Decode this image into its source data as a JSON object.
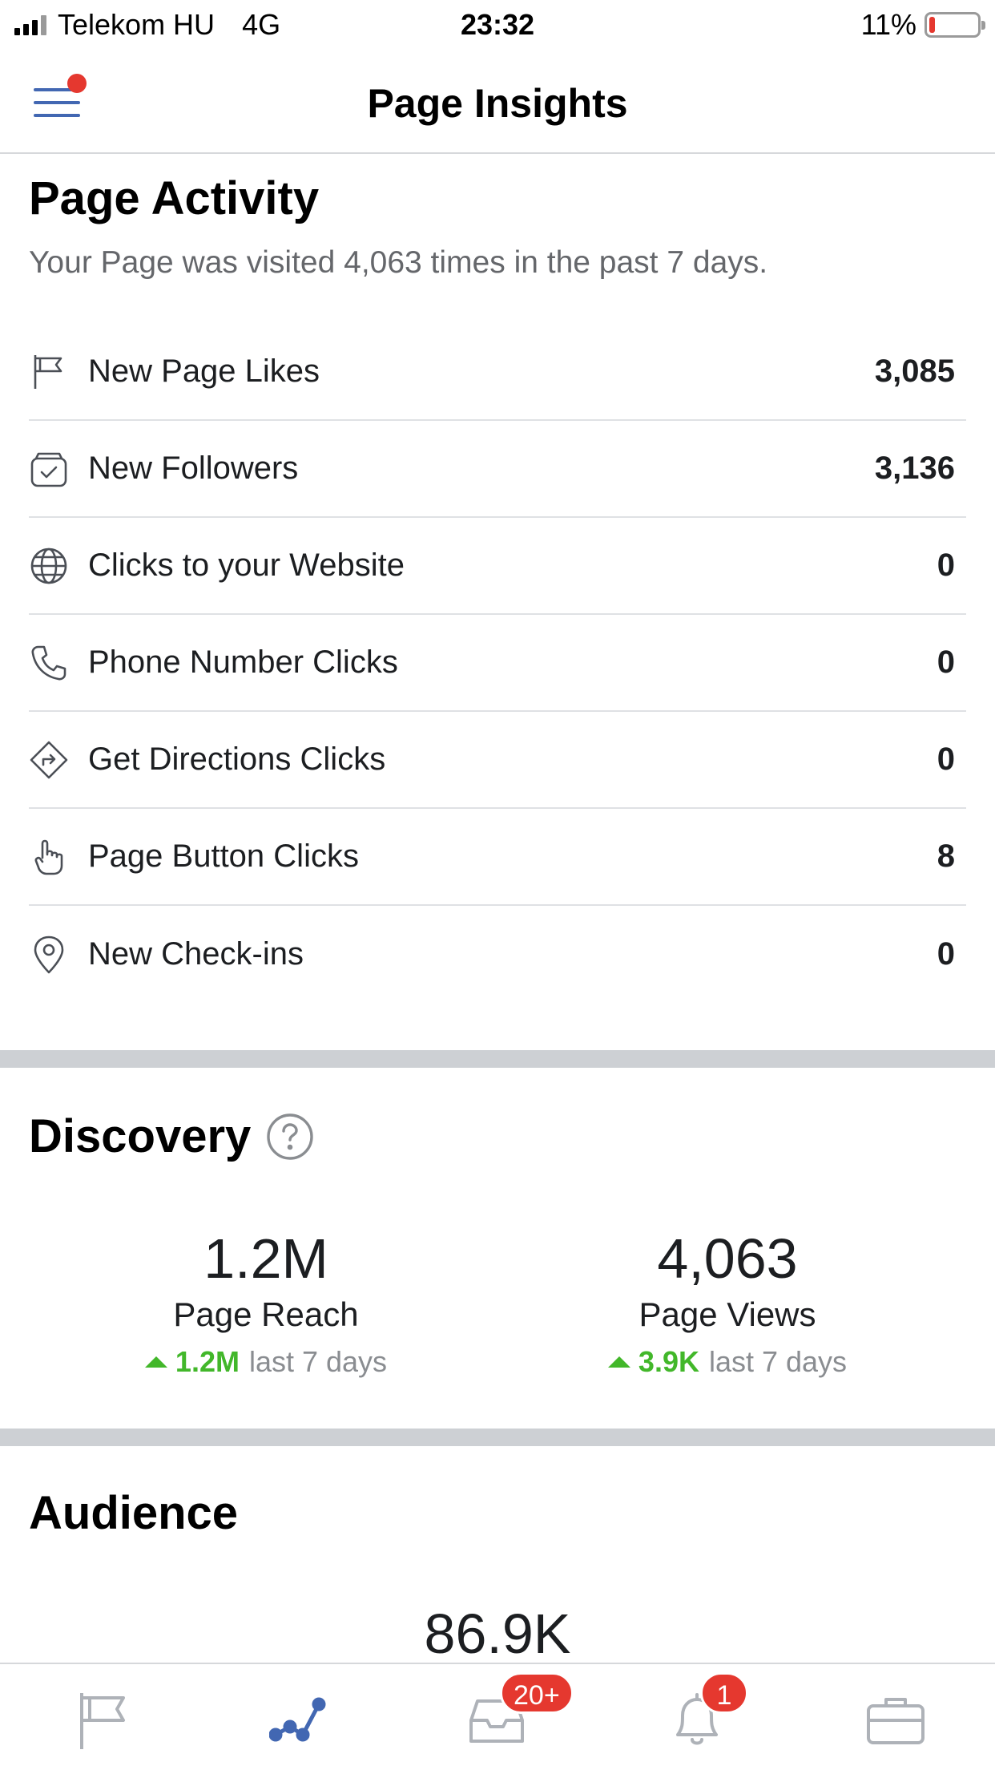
{
  "status_bar": {
    "carrier": "Telekom HU",
    "network": "4G",
    "time": "23:32",
    "battery": "11%",
    "battery_level": 0.11
  },
  "header": {
    "title": "Page Insights"
  },
  "page_activity": {
    "title": "Page Activity",
    "subtitle": "Your Page was visited 4,063 times in the past 7 days.",
    "metrics": [
      {
        "label": "New Page Likes",
        "value": "3,085",
        "icon": "flag-icon"
      },
      {
        "label": "New Followers",
        "value": "3,136",
        "icon": "followers-icon"
      },
      {
        "label": "Clicks to your Website",
        "value": "0",
        "icon": "globe-icon"
      },
      {
        "label": "Phone Number Clicks",
        "value": "0",
        "icon": "phone-icon"
      },
      {
        "label": "Get Directions Clicks",
        "value": "0",
        "icon": "directions-icon"
      },
      {
        "label": "Page Button Clicks",
        "value": "8",
        "icon": "pointer-hand-icon"
      },
      {
        "label": "New Check-ins",
        "value": "0",
        "icon": "location-pin-icon"
      }
    ]
  },
  "discovery": {
    "title": "Discovery",
    "stats": [
      {
        "value": "1.2M",
        "label": "Page Reach",
        "trend": "1.2M",
        "period": "last 7 days"
      },
      {
        "value": "4,063",
        "label": "Page Views",
        "trend": "3.9K",
        "period": "last 7 days"
      }
    ]
  },
  "audience": {
    "title": "Audience",
    "value": "86.9K"
  },
  "tab_bar": {
    "tabs": [
      {
        "name": "page",
        "icon": "flag-icon",
        "active": false
      },
      {
        "name": "insights",
        "icon": "insights-icon",
        "active": true
      },
      {
        "name": "inbox",
        "icon": "inbox-icon",
        "badge": "20+"
      },
      {
        "name": "notifications",
        "icon": "bell-icon",
        "badge": "1"
      },
      {
        "name": "tools",
        "icon": "briefcase-icon"
      }
    ]
  },
  "colors": {
    "accent": "#4267b2",
    "badge": "#e5382f",
    "trend_up": "#42b72a",
    "divider": "#cdd0d4"
  }
}
